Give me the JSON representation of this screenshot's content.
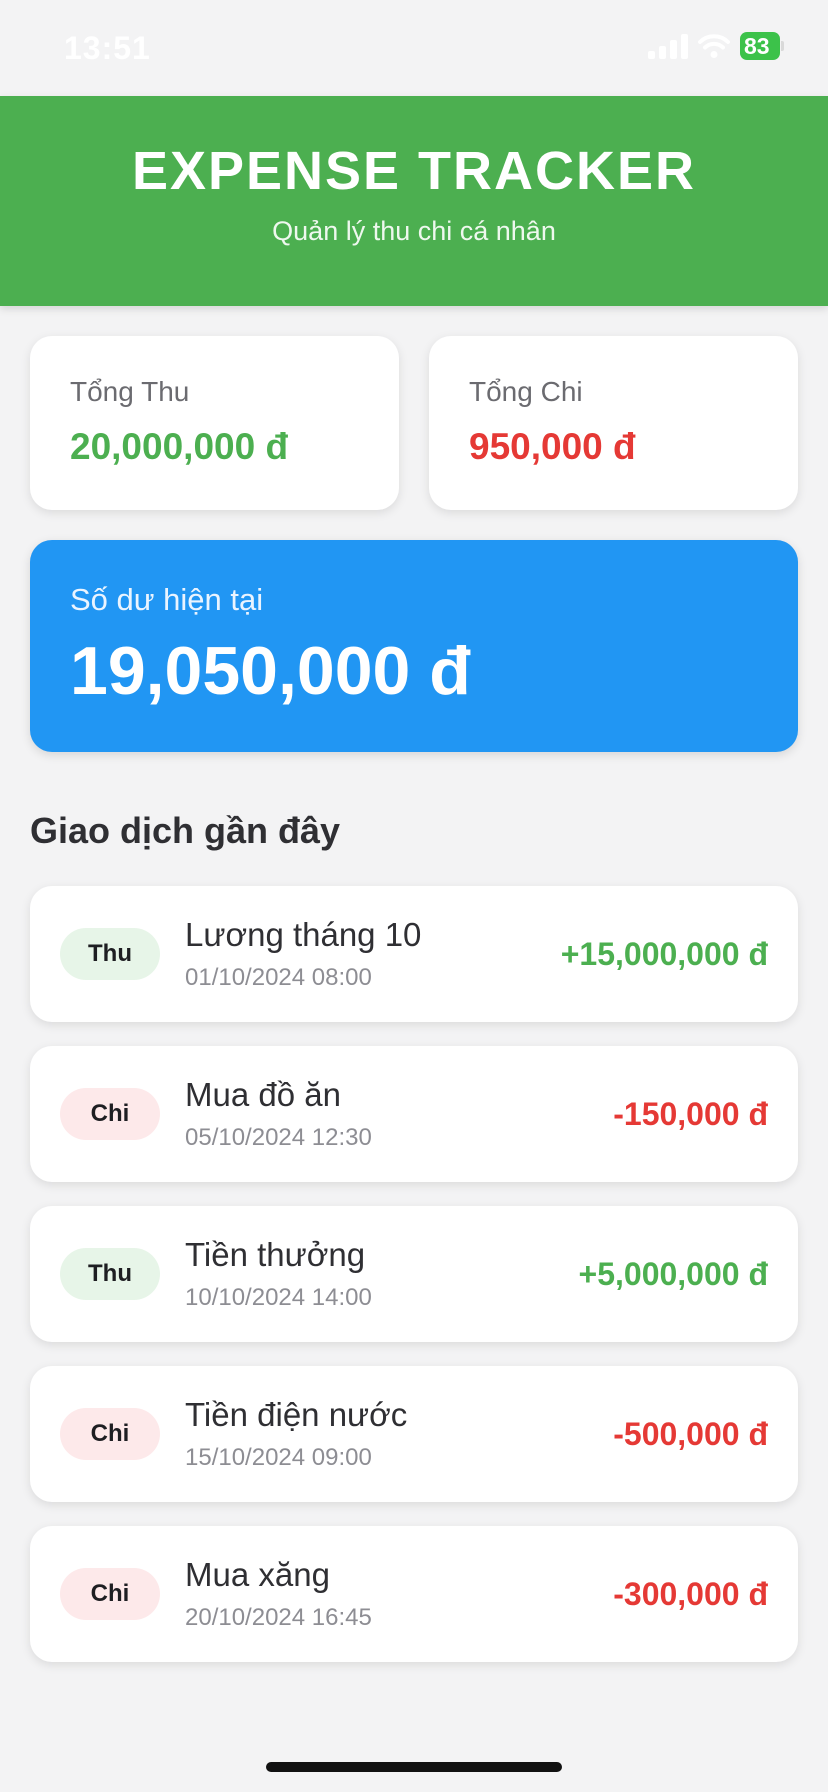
{
  "status_bar": {
    "time": "13:51",
    "battery": "83"
  },
  "header": {
    "title": "EXPENSE TRACKER",
    "subtitle": "Quản lý thu chi cá nhân"
  },
  "summary": {
    "income": {
      "label": "Tổng Thu",
      "value": "20,000,000 đ"
    },
    "expense": {
      "label": "Tổng Chi",
      "value": "950,000 đ"
    }
  },
  "balance": {
    "label": "Số dư hiện tại",
    "value": "19,050,000 đ"
  },
  "recent": {
    "title": "Giao dịch gần đây",
    "items": [
      {
        "type": "Thu",
        "title": "Lương tháng 10",
        "date": "01/10/2024 08:00",
        "amount": "+15,000,000 đ"
      },
      {
        "type": "Chi",
        "title": "Mua đồ ăn",
        "date": "05/10/2024 12:30",
        "amount": "-150,000 đ"
      },
      {
        "type": "Thu",
        "title": "Tiền thưởng",
        "date": "10/10/2024 14:00",
        "amount": "+5,000,000 đ"
      },
      {
        "type": "Chi",
        "title": "Tiền điện nước",
        "date": "15/10/2024 09:00",
        "amount": "-500,000 đ"
      },
      {
        "type": "Chi",
        "title": "Mua xăng",
        "date": "20/10/2024 16:45",
        "amount": "-300,000 đ"
      }
    ]
  },
  "colors": {
    "header": "#4caf50",
    "balance": "#2196f3",
    "income": "#4caf50",
    "expense": "#e53935"
  }
}
